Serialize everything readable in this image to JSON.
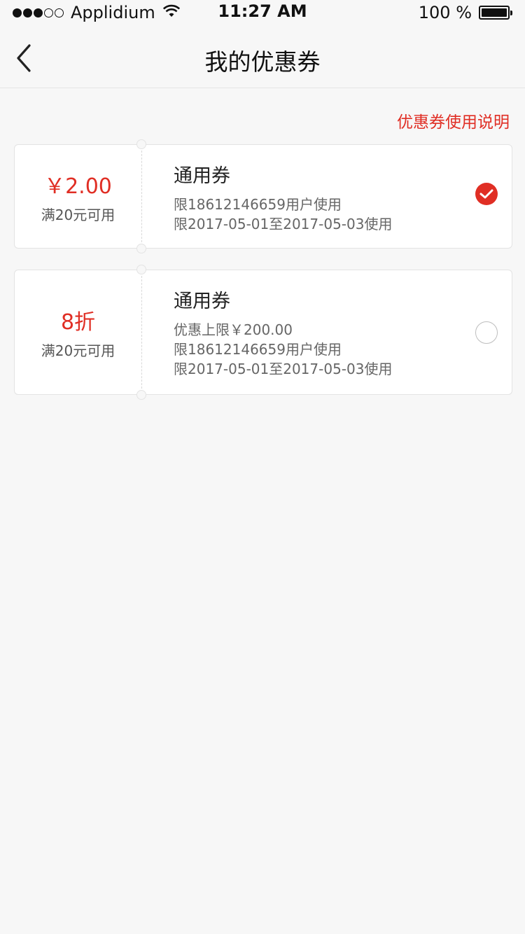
{
  "status_bar": {
    "carrier": "Applidium",
    "time": "11:27 AM",
    "battery": "100 %"
  },
  "nav": {
    "title": "我的优惠券",
    "back_icon": "chevron-left-icon"
  },
  "help_link": "优惠券使用说明",
  "accent_color": "#e02e24",
  "coupons": [
    {
      "value": "￥2.00",
      "condition": "满20元可用",
      "title": "通用券",
      "lines": [
        "限18612146659用户使用",
        "限2017-05-01至2017-05-03使用"
      ],
      "selected": true
    },
    {
      "value": "8折",
      "condition": "满20元可用",
      "title": "通用券",
      "lines": [
        "优惠上限￥200.00",
        "限18612146659用户使用",
        "限2017-05-01至2017-05-03使用"
      ],
      "selected": false
    }
  ]
}
